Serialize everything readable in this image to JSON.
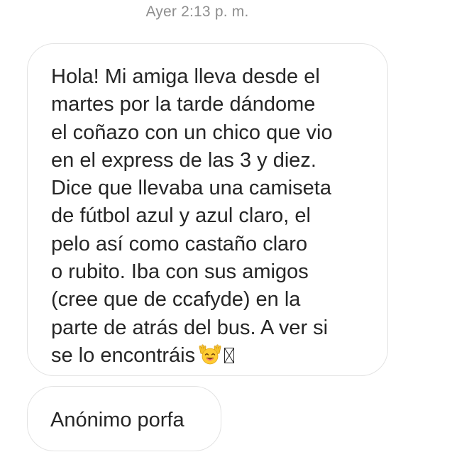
{
  "timestamp": "Ayer 2:13 p. m.",
  "messages": [
    {
      "lines": [
        "Hola! Mi amiga lleva desde el",
        "martes por la tarde dándome",
        "el coñazo con un chico que vio",
        "en el express de las 3 y diez.",
        "Dice que llevaba una camiseta",
        "de fútbol azul y azul claro, el",
        "pelo así como castaño claro",
        "o rubito. Iba con sus amigos",
        "(cree que de ccafyde) en la",
        "parte de atrás del bus. A ver si",
        "se lo encontráis"
      ],
      "emoji": "raising-hands-face-emoji"
    },
    {
      "text": "Anónimo porfa"
    }
  ],
  "colors": {
    "bubble_border": "#e3e3e3",
    "text": "#262626",
    "timestamp": "#8e8e8e"
  }
}
